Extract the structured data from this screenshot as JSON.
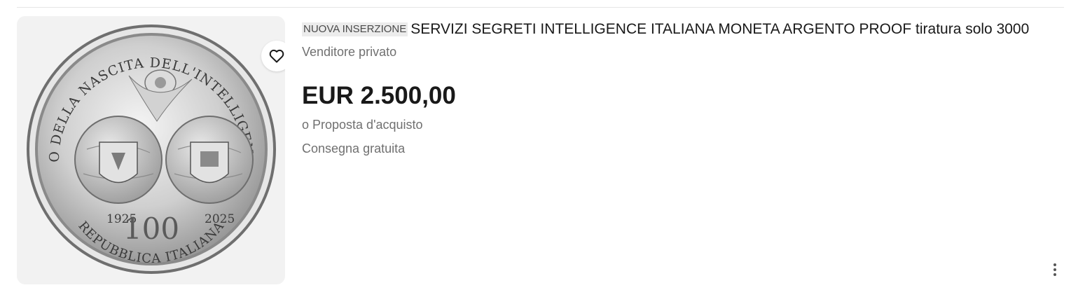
{
  "listing": {
    "badge": "NUOVA INSERZIONE",
    "title": "SERVIZI SEGRETI INTELLIGENCE ITALIANA MONETA ARGENTO PROOF tiratura solo 3000",
    "seller_type": "Venditore privato",
    "price": "EUR 2.500,00",
    "offer_text": "o Proposta d'acquisto",
    "shipping": "Consegna gratuita"
  },
  "coin": {
    "top_text": "CENTENARIO DELLA NASCITA DELL'INTELLIGENCE ITALIANA",
    "bottom_text": "REPUBBLICA ITALIANA",
    "year_left": "1925",
    "year_right": "2025",
    "centre_number": "100"
  },
  "icons": {
    "favorite": "heart-icon",
    "more": "more-vertical-icon"
  },
  "colors": {
    "text_primary": "#191919",
    "text_secondary": "#707070",
    "badge_bg": "#ececec",
    "image_bg": "#f2f2f2"
  }
}
